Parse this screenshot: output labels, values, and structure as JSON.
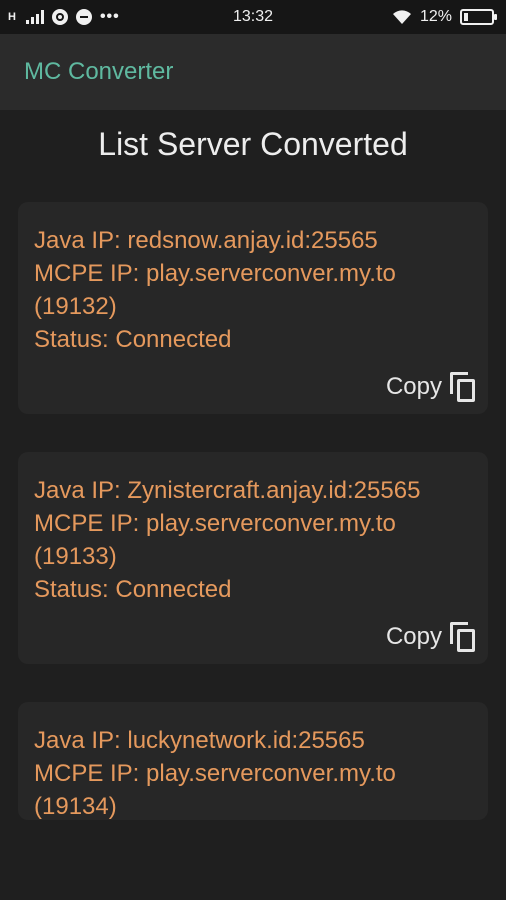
{
  "status_bar": {
    "network": "H",
    "time": "13:32",
    "battery": "12%",
    "icons": [
      "signal-icon",
      "whatsapp-icon",
      "chat-icon",
      "more-icon",
      "wifi-icon",
      "battery-icon"
    ]
  },
  "app_bar": {
    "title": "MC Converter"
  },
  "page_title": "List Server Converted",
  "cards": [
    {
      "java": "Java IP: redsnow.anjay.id:25565",
      "mcpe": "MCPE IP: play.serverconver.my.to",
      "port": "(19132)",
      "status": "Status: Connected",
      "copy": "Copy"
    },
    {
      "java": "Java IP: Zynistercraft.anjay.id:25565",
      "mcpe": "MCPE IP: play.serverconver.my.to",
      "port": "(19133)",
      "status": "Status: Connected",
      "copy": "Copy"
    },
    {
      "java": "Java IP: luckynetwork.id:25565",
      "mcpe": "MCPE IP: play.serverconver.my.to",
      "port": "(19134)"
    }
  ],
  "colors": {
    "accent": "#5fb9a0",
    "card_text": "#e5995d",
    "background": "#1f1f1f",
    "card": "#272727"
  }
}
